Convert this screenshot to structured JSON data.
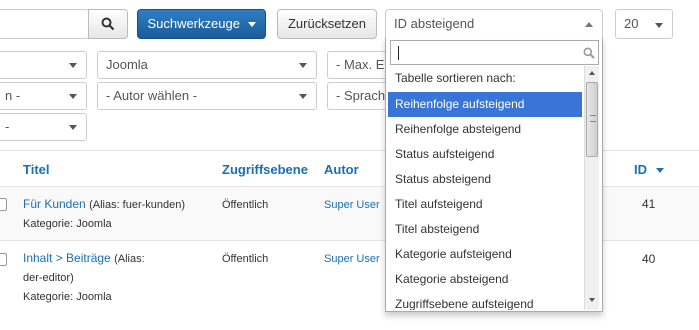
{
  "toolbar": {
    "search_tools_label": "Suchwerkzeuge",
    "reset_label": "Zurücksetzen",
    "sort_select_value": "ID absteigend",
    "limit_value": "20"
  },
  "filters": {
    "row1_left": "",
    "site_select": "Joomla",
    "max_levels": "- Max. E",
    "row2_left": "n -",
    "author_select": "- Autor wählen -",
    "language_select": "- Sprach",
    "row3_left": "-"
  },
  "table": {
    "headers": {
      "title": "Titel",
      "access": "Zugriffsebene",
      "author": "Autor",
      "id": "ID"
    },
    "rows": [
      {
        "title": "Für Kunden",
        "alias": "(Alias: fuer-kunden)",
        "category": "Kategorie: Joomla",
        "access": "Öffentlich",
        "author": "Super User",
        "id": "41"
      },
      {
        "title": "Inhalt > Beiträge",
        "alias": "(Alias:",
        "alias2": "der-editor)",
        "category": "Kategorie: Joomla",
        "access": "Öffentlich",
        "author": "Super User",
        "id": "40"
      }
    ]
  },
  "dropdown": {
    "search_value": "",
    "group_label": "Tabelle sortieren nach:",
    "options": [
      "Reihenfolge aufsteigend",
      "Reihenfolge absteigend",
      "Status aufsteigend",
      "Status absteigend",
      "Titel aufsteigend",
      "Titel absteigend",
      "Kategorie aufsteigend",
      "Kategorie absteigend",
      "Zugriffsebene aufsteigend"
    ],
    "selected_index": 0
  },
  "colors": {
    "primary": "#1a6fb5",
    "highlight": "#3875d7"
  },
  "icons": [
    "search-icon",
    "caret-down-icon",
    "caret-up-icon",
    "sort-desc-icon"
  ]
}
